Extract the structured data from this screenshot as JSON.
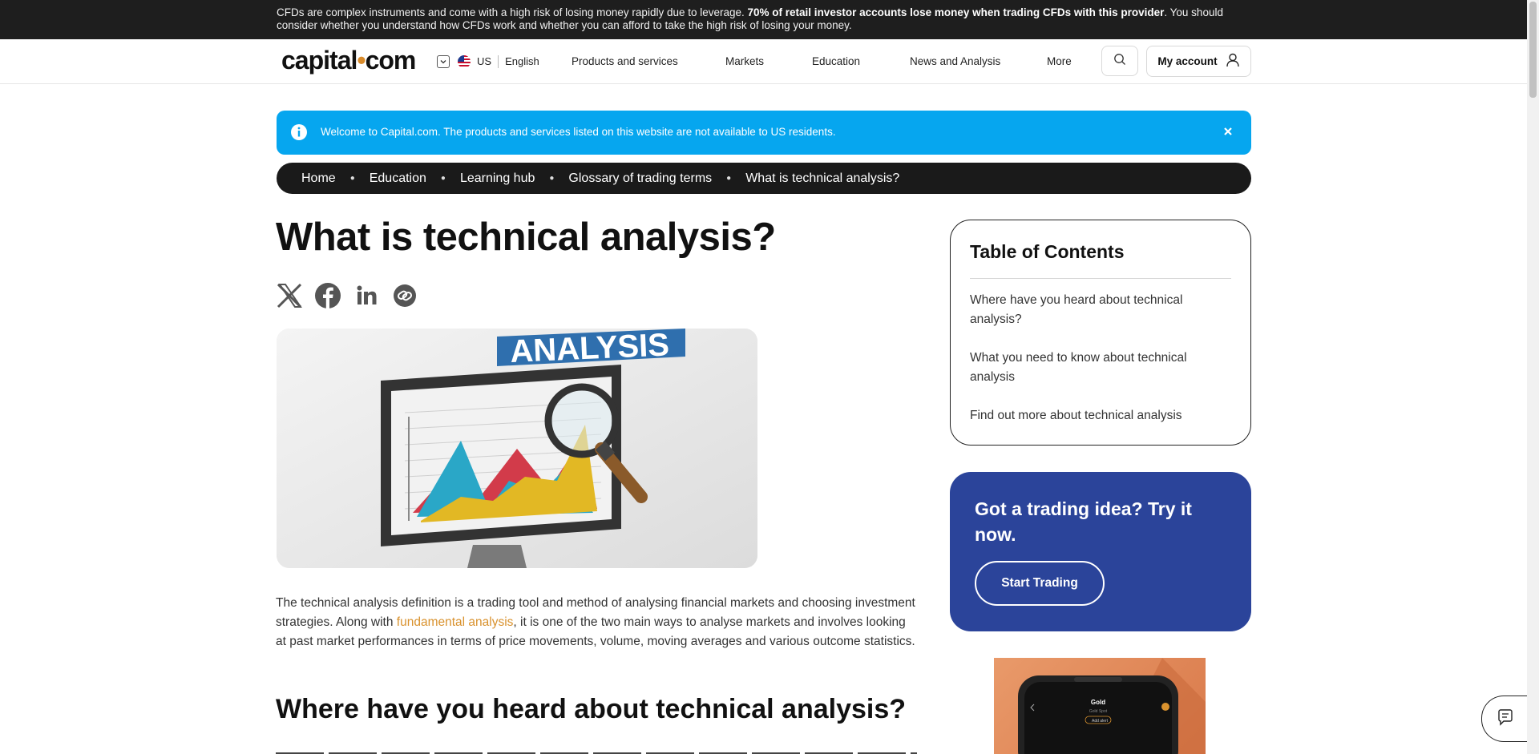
{
  "risk_warning": {
    "part1": "CFDs are complex instruments and come with a high risk of losing money rapidly due to leverage. ",
    "bold": "70% of retail investor accounts lose money when trading CFDs with this provider",
    "part2": ". You should consider whether you understand how CFDs work and whether you can afford to take the high risk of losing your money."
  },
  "header": {
    "logo_main": "capital",
    "logo_dot": "•",
    "logo_end": "com",
    "region": "US",
    "language": "English",
    "nav": [
      "Products and services",
      "Markets",
      "Education",
      "News and Analysis",
      "More"
    ],
    "account_label": "My account"
  },
  "notice": {
    "text": "Welcome to Capital.com. The products and services listed on this website are not available to US residents."
  },
  "breadcrumb": [
    "Home",
    "Education",
    "Learning hub",
    "Glossary of trading terms",
    "What is technical analysis?"
  ],
  "article": {
    "title": "What is technical analysis?",
    "hero_banner": "ANALYSIS",
    "para_before_link": "The technical analysis definition is a trading tool and method of analysing financial markets and choosing investment strategies. Along with ",
    "para_link": "fundamental analysis",
    "para_after_link": ", it is one of the two main ways to analyse markets and involves looking at past market performances in terms of price movements, volume, moving averages and various outcome statistics.",
    "h2": "Where have you heard about technical analysis?"
  },
  "toc": {
    "title": "Table of Contents",
    "items": [
      "Where have you heard about technical analysis?",
      "What you need to know about technical analysis",
      "Find out more about technical analysis"
    ]
  },
  "cta": {
    "title": "Got a trading idea? Try it now.",
    "button": "Start Trading"
  },
  "promo": {
    "asset": "Gold",
    "sub": "Gold Spot",
    "tag": "Add alert"
  },
  "colors": {
    "risk_bar": "#1e1e1e",
    "notice_blue": "#06a6ef",
    "cta_blue": "#2b449a",
    "link_orange": "#d9922e"
  },
  "icons": [
    "chevron-down-icon",
    "us-flag-icon",
    "search-icon",
    "user-icon",
    "info-icon",
    "close-icon",
    "x-twitter-icon",
    "facebook-icon",
    "linkedin-icon",
    "copy-link-icon",
    "chat-icon"
  ]
}
